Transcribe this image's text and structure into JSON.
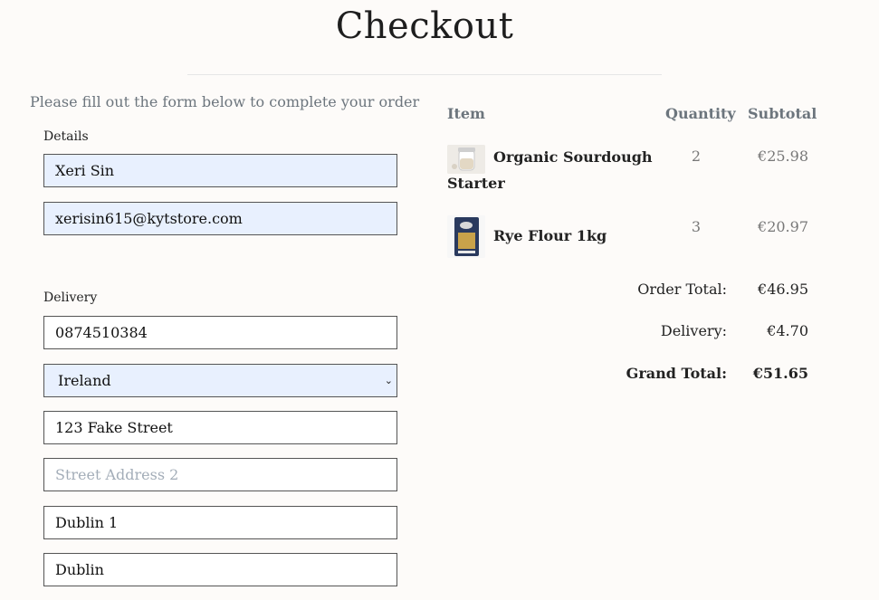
{
  "page": {
    "title": "Checkout",
    "intro": "Please fill out the form below to complete your order"
  },
  "details": {
    "label": "Details",
    "full_name": "Xeri Sin",
    "email": "xerisin615@kytstore.com"
  },
  "delivery": {
    "label": "Delivery",
    "phone": "0874510384",
    "country": "Ireland",
    "street1": "123 Fake Street",
    "street2_placeholder": "Street Address 2",
    "town": "Dublin 1",
    "county": "Dublin"
  },
  "summary": {
    "headers": {
      "item": "Item",
      "quantity": "Quantity",
      "subtotal": "Subtotal"
    },
    "items": [
      {
        "name": "Organic Sourdough Starter",
        "name_line1": "Organic Sourdough",
        "name_line2": "Starter",
        "quantity": "2",
        "subtotal": "€25.98"
      },
      {
        "name": "Rye Flour 1kg",
        "quantity": "3",
        "subtotal": "€20.97"
      }
    ],
    "order_total_label": "Order Total:",
    "order_total": "€46.95",
    "delivery_label": "Delivery:",
    "delivery_cost": "€4.70",
    "grand_total_label": "Grand Total:",
    "grand_total": "€51.65"
  },
  "colors": {
    "autofill_bg": "#e8f0fe",
    "muted_text": "#6c757d",
    "page_bg": "#fdfbf9"
  }
}
